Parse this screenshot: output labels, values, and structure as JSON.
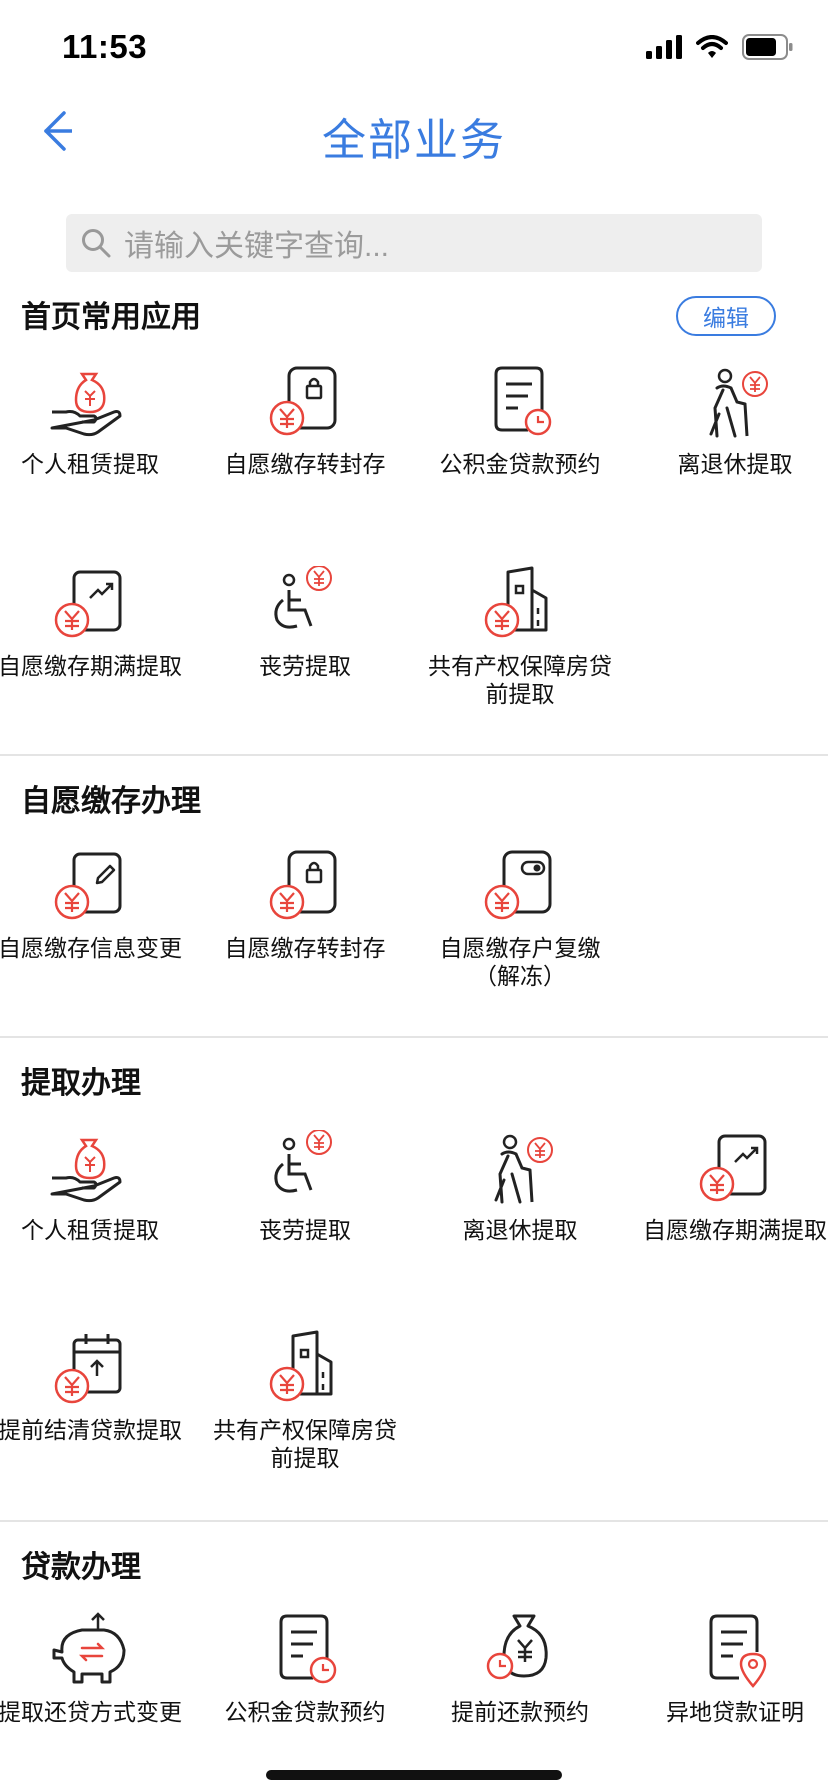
{
  "status": {
    "time": "11:53"
  },
  "nav": {
    "title": "全部业务"
  },
  "search": {
    "placeholder": "请输入关键字查询..."
  },
  "sections": [
    {
      "title": "首页常用应用",
      "edit_label": "编辑",
      "items": [
        {
          "label": "个人租赁提取",
          "icon": "rent-hand-money-icon"
        },
        {
          "label": "自愿缴存转封存",
          "icon": "deposit-lock-icon"
        },
        {
          "label": "公积金贷款预约",
          "icon": "document-clock-icon"
        },
        {
          "label": "离退休提取",
          "icon": "elderly-money-icon"
        },
        {
          "label": "自愿缴存期满提取",
          "icon": "deposit-trend-icon"
        },
        {
          "label": "丧劳提取",
          "icon": "wheelchair-money-icon"
        },
        {
          "label": "共有产权保障房贷前提取",
          "icon": "building-money-icon"
        }
      ]
    },
    {
      "title": "自愿缴存办理",
      "items": [
        {
          "label": "自愿缴存信息变更",
          "icon": "deposit-edit-icon"
        },
        {
          "label": "自愿缴存转封存",
          "icon": "deposit-lock-icon"
        },
        {
          "label": "自愿缴存户复缴（解冻）",
          "icon": "deposit-toggle-icon"
        }
      ]
    },
    {
      "title": "提取办理",
      "items": [
        {
          "label": "个人租赁提取",
          "icon": "rent-hand-money-icon"
        },
        {
          "label": "丧劳提取",
          "icon": "wheelchair-money-icon"
        },
        {
          "label": "离退休提取",
          "icon": "elderly-money-icon"
        },
        {
          "label": "自愿缴存期满提取",
          "icon": "deposit-trend-icon"
        },
        {
          "label": "提前结清贷款提取",
          "icon": "calendar-money-icon"
        },
        {
          "label": "共有产权保障房贷前提取",
          "icon": "building-money-icon"
        }
      ]
    },
    {
      "title": "贷款办理",
      "items": [
        {
          "label": "提取还贷方式变更",
          "icon": "piggy-bank-icon"
        },
        {
          "label": "公积金贷款预约",
          "icon": "document-clock-icon"
        },
        {
          "label": "提前还款预约",
          "icon": "money-bag-clock-icon"
        },
        {
          "label": "异地贷款证明",
          "icon": "document-location-icon"
        }
      ]
    }
  ],
  "colors": {
    "accent": "#3a7ce0",
    "icon_red": "#e8453c",
    "icon_dark": "#222222"
  }
}
